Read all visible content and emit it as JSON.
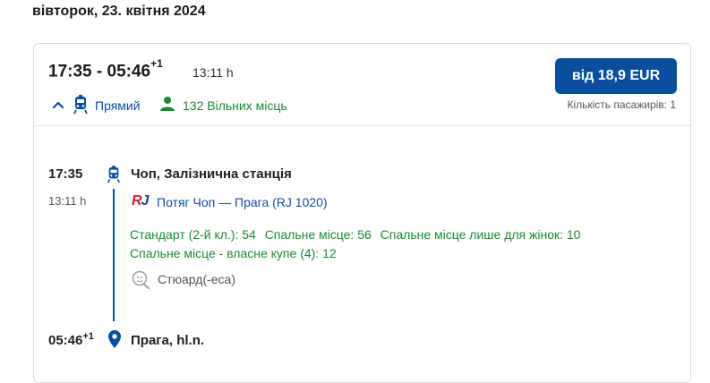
{
  "date_heading": "вівторок, 23. квітня 2024",
  "summary": {
    "departure": "17:35",
    "separator": " - ",
    "arrival": "05:46",
    "day_offset": "+1",
    "duration": "13:11 h",
    "direct_label": "Прямий",
    "seats_label": "132 Вільних місць"
  },
  "price_button": "від 18,9 EUR",
  "passengers": "Кількість пасажирів: 1",
  "departure_stop": {
    "time": "17:35",
    "station": "Чоп, Залізнична станція"
  },
  "segment": {
    "duration": "13:11 h",
    "logo_r": "R",
    "logo_j": "J",
    "train_name": "Потяг Чоп — Прага (RJ 1020)",
    "classes": [
      "Стандарт (2-й кл.): 54",
      "Спальне місце: 56",
      "Спальне місце лише для жінок: 10",
      "Спальне місце - власне купе (4): 12"
    ],
    "service": "Стюард(-еса)"
  },
  "arrival_stop": {
    "time": "05:46",
    "day_offset": "+1",
    "station": "Прага, hl.n."
  },
  "colors": {
    "primary": "#0a4f9e",
    "available": "#1a8a2e",
    "rj_red": "#d21f2b",
    "rj_blue": "#1f3f93"
  },
  "icons": [
    "chevron-up-icon",
    "train-icon",
    "person-icon",
    "steward-icon",
    "location-pin-icon"
  ]
}
